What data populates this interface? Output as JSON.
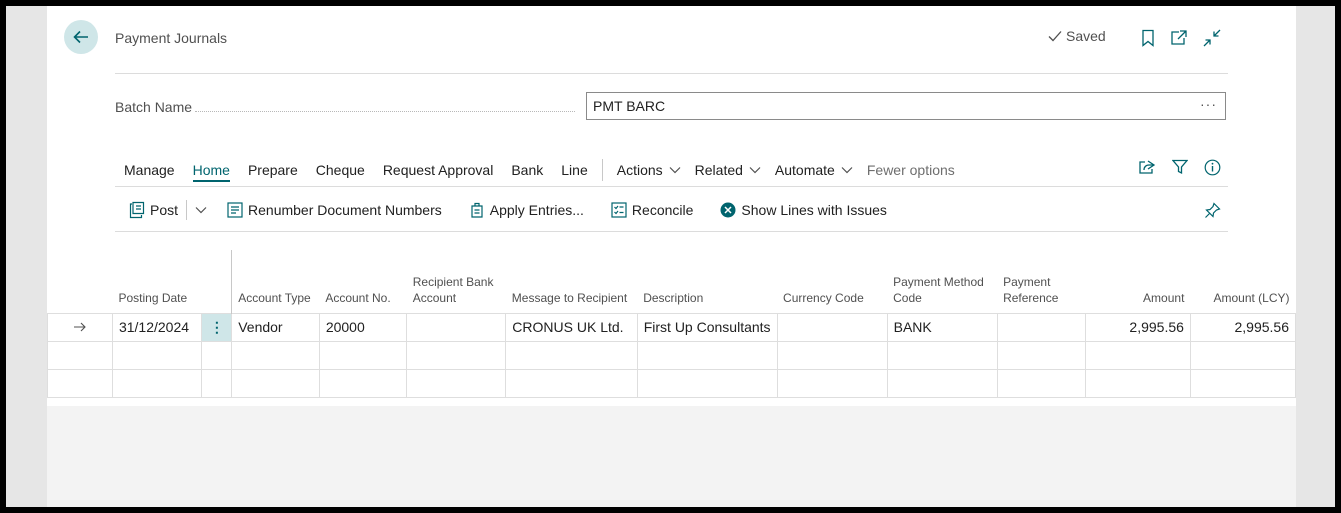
{
  "header": {
    "title": "Payment Journals",
    "saved_label": "Saved"
  },
  "batch": {
    "label": "Batch Name",
    "value": "PMT BARC",
    "more": "···"
  },
  "tabs": [
    {
      "label": "Manage"
    },
    {
      "label": "Home"
    },
    {
      "label": "Prepare"
    },
    {
      "label": "Cheque"
    },
    {
      "label": "Request Approval"
    },
    {
      "label": "Bank"
    },
    {
      "label": "Line"
    }
  ],
  "menus": [
    {
      "label": "Actions"
    },
    {
      "label": "Related"
    },
    {
      "label": "Automate"
    }
  ],
  "fewer_options": "Fewer options",
  "actions": {
    "post": "Post",
    "renumber": "Renumber Document Numbers",
    "apply": "Apply Entries...",
    "reconcile": "Reconcile",
    "show_issues": "Show Lines with Issues"
  },
  "columns": {
    "posting_date": "Posting Date",
    "account_type": "Account Type",
    "account_no": "Account No.",
    "recipient_bank": "Recipient Bank Account",
    "message": "Message to Recipient",
    "description": "Description",
    "currency": "Currency Code",
    "payment_method": "Payment Method Code",
    "payment_ref": "Payment Reference",
    "amount": "Amount",
    "amount_lcy": "Amount (LCY)"
  },
  "rows": [
    {
      "posting_date": "31/12/2024",
      "account_type": "Vendor",
      "account_no": "20000",
      "recipient_bank": "",
      "message": "CRONUS UK Ltd.",
      "description": "First Up Consultants",
      "currency": "",
      "payment_method": "BANK",
      "payment_ref": "",
      "amount": "2,995.56",
      "amount_lcy": "2,995.56"
    }
  ],
  "colors": {
    "accent": "#00646e",
    "accent_light": "#cfe6e8"
  }
}
